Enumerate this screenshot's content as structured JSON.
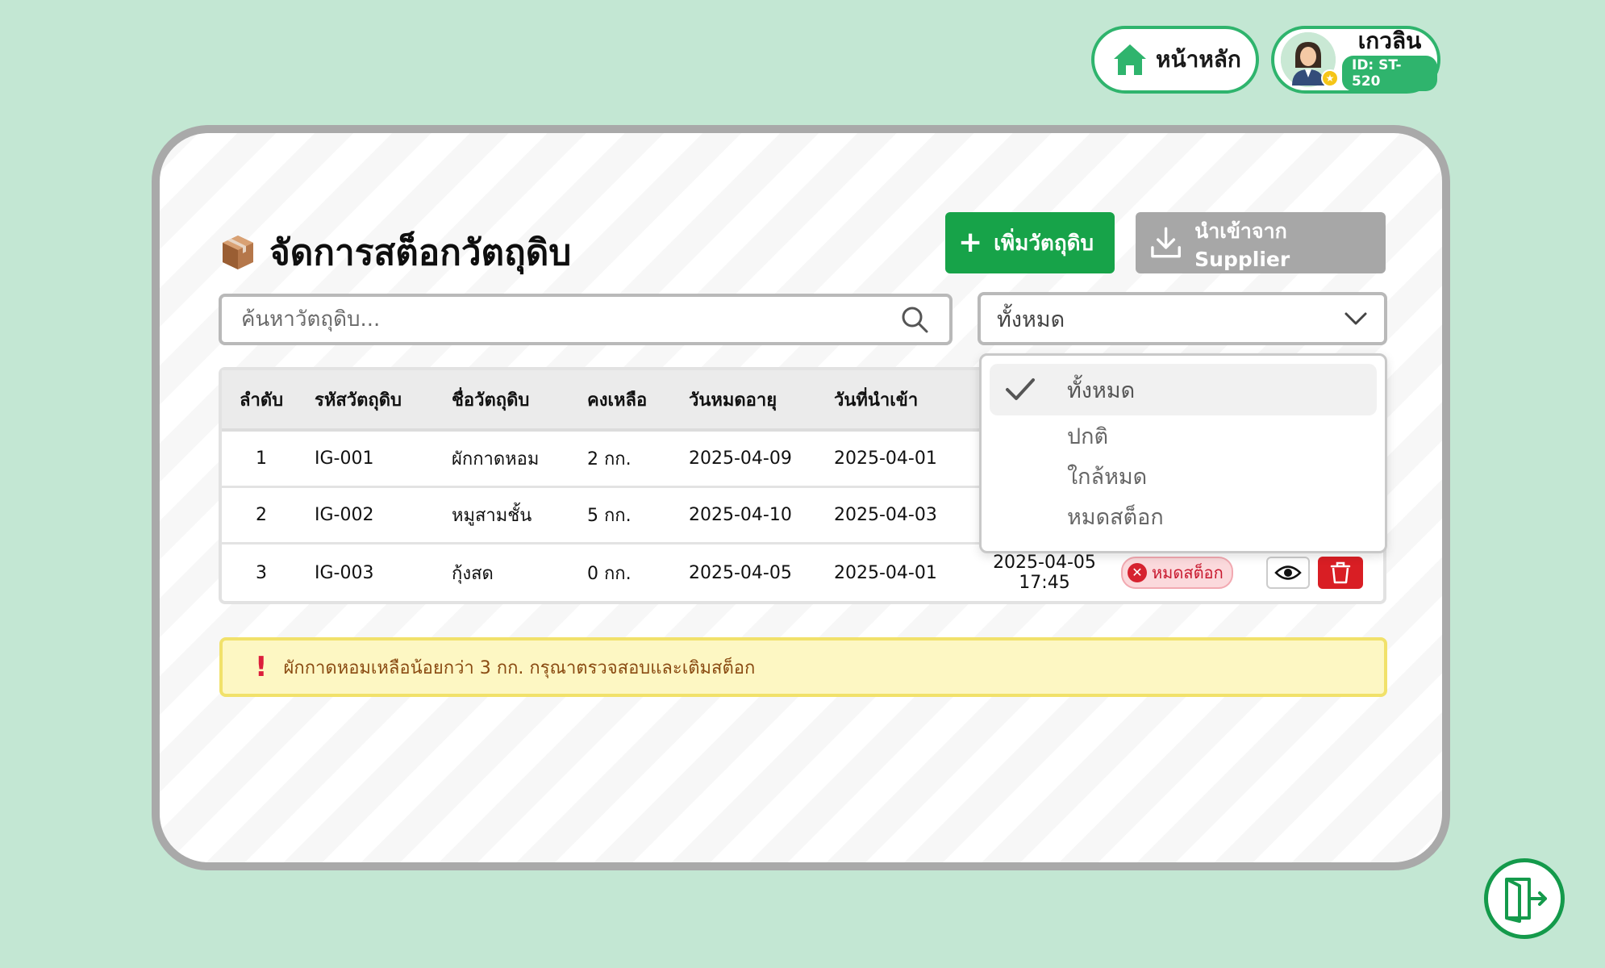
{
  "nav": {
    "home_label": "หน้าหลัก",
    "user_name": "เกวลิน",
    "user_id": "ID: ST-520"
  },
  "page": {
    "title": "จัดการสต็อกวัตถุดิบ",
    "add_label": "เพิ่มวัตถุดิบ",
    "import_label": "นำเข้าจาก Supplier"
  },
  "search": {
    "placeholder": "ค้นหาวัตถุดิบ..."
  },
  "filter": {
    "selected": "ทั้งหมด",
    "options": [
      "ทั้งหมด",
      "ปกติ",
      "ใกล้หมด",
      "หมดสต็อก"
    ]
  },
  "table": {
    "headers": [
      "ลำดับ",
      "รหัสวัตถุดิบ",
      "ชื่อวัตถุดิบ",
      "คงเหลือ",
      "วันหมดอายุ",
      "วันที่นำเข้า"
    ],
    "rows": [
      {
        "no": "1",
        "code": "IG-001",
        "name": "ผักกาดหอม",
        "qty": "2 กก.",
        "expiry": "2025-04-09",
        "imported": "2025-04-01"
      },
      {
        "no": "2",
        "code": "IG-002",
        "name": "หมูสามชั้น",
        "qty": "5 กก.",
        "expiry": "2025-04-10",
        "imported": "2025-04-03"
      },
      {
        "no": "3",
        "code": "IG-003",
        "name": "กุ้งสด",
        "qty": "0 กก.",
        "expiry": "2025-04-05",
        "imported": "2025-04-01",
        "updated_date": "2025-04-05",
        "updated_time": "17:45",
        "status": "หมดสต็อก"
      }
    ]
  },
  "alert": {
    "mark": "!",
    "message": "ผักกาดหอมเหลือน้อยกว่า 3 กก. กรุณาตรวจสอบและเติมสต็อก"
  },
  "colors": {
    "accent": "#17a349",
    "danger": "#d91e24",
    "background": "#c3e7d3"
  },
  "icons": [
    "home-icon",
    "avatar",
    "box-icon",
    "plus-icon",
    "download-icon",
    "search-icon",
    "chevron-down-icon",
    "check-icon",
    "eye-icon",
    "trash-icon",
    "logout-icon"
  ]
}
